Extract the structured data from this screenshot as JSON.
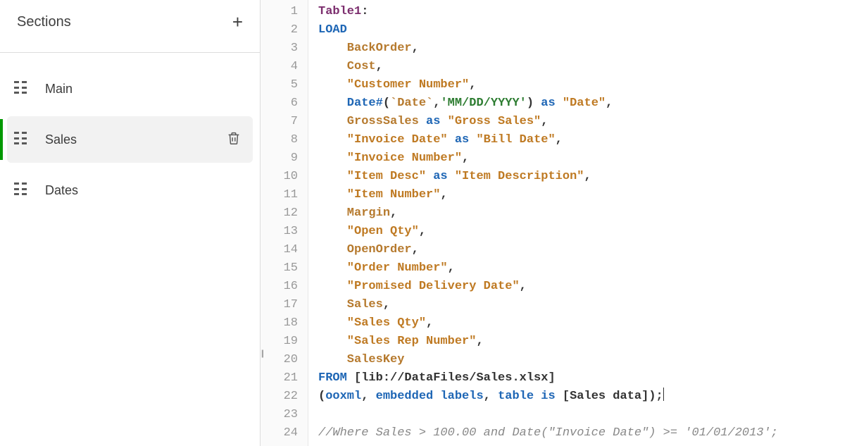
{
  "sidebar": {
    "title": "Sections",
    "add_glyph": "+",
    "items": [
      {
        "label": "Main",
        "active": false,
        "showDelete": false
      },
      {
        "label": "Sales",
        "active": true,
        "showDelete": true
      },
      {
        "label": "Dates",
        "active": false,
        "showDelete": false
      }
    ]
  },
  "editor": {
    "lineNumbers": [
      "1",
      "2",
      "3",
      "4",
      "5",
      "6",
      "7",
      "8",
      "9",
      "10",
      "11",
      "12",
      "13",
      "14",
      "15",
      "16",
      "17",
      "18",
      "19",
      "20",
      "21",
      "22",
      "23",
      "24"
    ],
    "lines": [
      [
        {
          "t": "Table1",
          "c": "tk-def"
        },
        {
          "t": ":",
          "c": "tk-punct"
        }
      ],
      [
        {
          "t": "LOAD",
          "c": "tk-kw"
        }
      ],
      [
        {
          "t": "    BackOrder",
          "c": "tk-ident"
        },
        {
          "t": ",",
          "c": "tk-punct"
        }
      ],
      [
        {
          "t": "    Cost",
          "c": "tk-ident"
        },
        {
          "t": ",",
          "c": "tk-punct"
        }
      ],
      [
        {
          "t": "    \"Customer Number\"",
          "c": "tk-str"
        },
        {
          "t": ",",
          "c": "tk-punct"
        }
      ],
      [
        {
          "t": "    Date#",
          "c": "tk-kw"
        },
        {
          "t": "(",
          "c": "tk-punct"
        },
        {
          "t": "`Date`",
          "c": "tk-ident"
        },
        {
          "t": ",",
          "c": "tk-punct"
        },
        {
          "t": "'MM/DD/YYYY'",
          "c": "tk-lit"
        },
        {
          "t": ")",
          "c": "tk-punct"
        },
        {
          "t": " as ",
          "c": "tk-kw"
        },
        {
          "t": "\"Date\"",
          "c": "tk-str"
        },
        {
          "t": ",",
          "c": "tk-punct"
        }
      ],
      [
        {
          "t": "    GrossSales",
          "c": "tk-ident"
        },
        {
          "t": " as ",
          "c": "tk-kw"
        },
        {
          "t": "\"Gross Sales\"",
          "c": "tk-str"
        },
        {
          "t": ",",
          "c": "tk-punct"
        }
      ],
      [
        {
          "t": "    \"Invoice Date\"",
          "c": "tk-str"
        },
        {
          "t": " as ",
          "c": "tk-kw"
        },
        {
          "t": "\"Bill Date\"",
          "c": "tk-str"
        },
        {
          "t": ",",
          "c": "tk-punct"
        }
      ],
      [
        {
          "t": "    \"Invoice Number\"",
          "c": "tk-str"
        },
        {
          "t": ",",
          "c": "tk-punct"
        }
      ],
      [
        {
          "t": "    \"Item Desc\"",
          "c": "tk-str"
        },
        {
          "t": " as ",
          "c": "tk-kw"
        },
        {
          "t": "\"Item Description\"",
          "c": "tk-str"
        },
        {
          "t": ",",
          "c": "tk-punct"
        }
      ],
      [
        {
          "t": "    \"Item Number\"",
          "c": "tk-str"
        },
        {
          "t": ",",
          "c": "tk-punct"
        }
      ],
      [
        {
          "t": "    Margin",
          "c": "tk-ident"
        },
        {
          "t": ",",
          "c": "tk-punct"
        }
      ],
      [
        {
          "t": "    \"Open Qty\"",
          "c": "tk-str"
        },
        {
          "t": ",",
          "c": "tk-punct"
        }
      ],
      [
        {
          "t": "    OpenOrder",
          "c": "tk-ident"
        },
        {
          "t": ",",
          "c": "tk-punct"
        }
      ],
      [
        {
          "t": "    \"Order Number\"",
          "c": "tk-str"
        },
        {
          "t": ",",
          "c": "tk-punct"
        }
      ],
      [
        {
          "t": "    \"Promised Delivery Date\"",
          "c": "tk-str"
        },
        {
          "t": ",",
          "c": "tk-punct"
        }
      ],
      [
        {
          "t": "    Sales",
          "c": "tk-ident"
        },
        {
          "t": ",",
          "c": "tk-punct"
        }
      ],
      [
        {
          "t": "    \"Sales Qty\"",
          "c": "tk-str"
        },
        {
          "t": ",",
          "c": "tk-punct"
        }
      ],
      [
        {
          "t": "    \"Sales Rep Number\"",
          "c": "tk-str"
        },
        {
          "t": ",",
          "c": "tk-punct"
        }
      ],
      [
        {
          "t": "    SalesKey",
          "c": "tk-ident"
        }
      ],
      [
        {
          "t": "FROM ",
          "c": "tk-kw"
        },
        {
          "t": "[lib://DataFiles/Sales.xlsx]",
          "c": "tk-brkt"
        }
      ],
      [
        {
          "t": "(",
          "c": "tk-punct"
        },
        {
          "t": "ooxml",
          "c": "tk-kw"
        },
        {
          "t": ", ",
          "c": "tk-punct"
        },
        {
          "t": "embedded labels",
          "c": "tk-kw"
        },
        {
          "t": ", ",
          "c": "tk-punct"
        },
        {
          "t": "table is ",
          "c": "tk-kw"
        },
        {
          "t": "[Sales data]",
          "c": "tk-brkt"
        },
        {
          "t": ");",
          "c": "tk-punct"
        },
        {
          "t": "__CURSOR__",
          "c": "cursor-marker"
        }
      ],
      [],
      [
        {
          "t": "//Where Sales > 100.00 and Date(\"Invoice Date\") >= '01/01/2013';",
          "c": "tk-cmt"
        }
      ]
    ]
  }
}
